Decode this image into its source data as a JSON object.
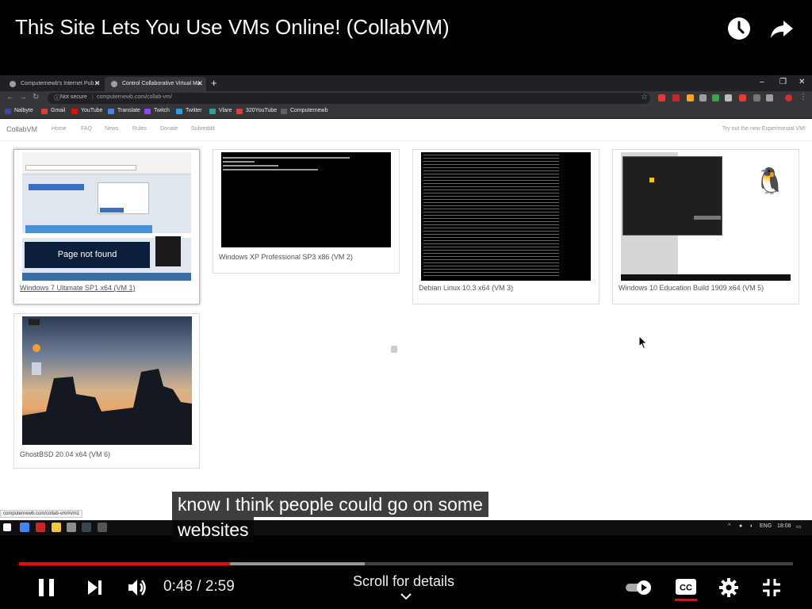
{
  "video": {
    "title": "This Site Lets You Use VMs Online! (CollabVM)",
    "current_time": "0:48",
    "separator": "/",
    "duration": "2:59",
    "played_fraction": 0.273,
    "buffered_fraction": 0.447,
    "scroll_hint": "Scroll for details",
    "caption_lines": [
      "know I think people could go on some",
      "websites"
    ],
    "accent_color": "#ff0000"
  },
  "browser": {
    "tabs": [
      {
        "label": "Computernewb's Internet Pub H",
        "active": false
      },
      {
        "label": "Control Collaborative Virtual Ma",
        "active": true
      }
    ],
    "security": "Not secure",
    "url": "computernewb.com/collab-vm/",
    "status_url": "computernewb.com/collab-vm/#vm1",
    "bookmarks": [
      "Nalbyte",
      "Gmail",
      "YouTube",
      "Translate",
      "Twitch",
      "Twitter",
      "Vlare",
      "320YouTube",
      "Computernewb"
    ]
  },
  "site": {
    "brand": "CollabVM",
    "nav": [
      "Home",
      "FAQ",
      "News",
      "Rules",
      "Donate",
      "Subreddit"
    ],
    "right_link": "Try out the new Experimental VM!"
  },
  "vms": [
    {
      "label": "Windows 7 Ultimate SP1 x64 (VM 1)",
      "thumb_text": "Page not found"
    },
    {
      "label": "Windows XP Professional SP3 x86 (VM 2)"
    },
    {
      "label": "Debian Linux 10.3 x64 (VM 3)"
    },
    {
      "label": "Windows 10 Education Build 1909 x64 (VM 5)"
    },
    {
      "label": "GhostBSD 20.04 x64 (VM 6)"
    }
  ],
  "taskbar": {
    "lang": "ENG",
    "clock": "18:08"
  },
  "icons": {
    "watch_later": "clock-icon",
    "share": "share-arrow-icon",
    "pause": "pause-icon",
    "next": "skip-next-icon",
    "volume": "volume-icon",
    "autoplay": "autoplay-toggle-icon",
    "captions": "cc-icon",
    "settings": "gear-icon",
    "exit_fullscreen": "exit-fullscreen-icon"
  }
}
